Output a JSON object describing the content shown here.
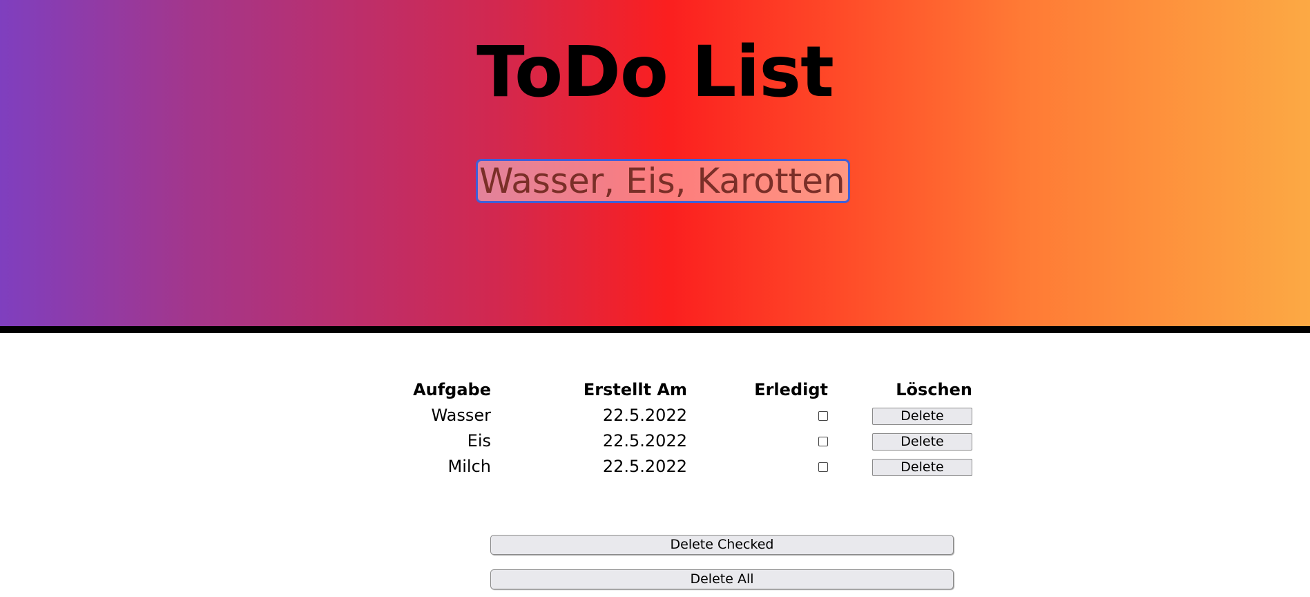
{
  "header": {
    "title": "ToDo List",
    "input_placeholder": "Wasser, Eis, Karotten,...",
    "gradient_colors": [
      "#7f3fbf",
      "#d2284f",
      "#fb1f1f",
      "#ff7a35",
      "#fca944"
    ]
  },
  "table": {
    "headers": {
      "task": "Aufgabe",
      "created": "Erstellt Am",
      "done": "Erledigt",
      "delete": "Löschen"
    },
    "rows": [
      {
        "task": "Wasser",
        "created": "22.5.2022",
        "done": false,
        "delete_label": "Delete"
      },
      {
        "task": "Eis",
        "created": "22.5.2022",
        "done": false,
        "delete_label": "Delete"
      },
      {
        "task": "Milch",
        "created": "22.5.2022",
        "done": false,
        "delete_label": "Delete"
      }
    ]
  },
  "actions": {
    "delete_checked_label": "Delete Checked",
    "delete_all_label": "Delete All"
  }
}
